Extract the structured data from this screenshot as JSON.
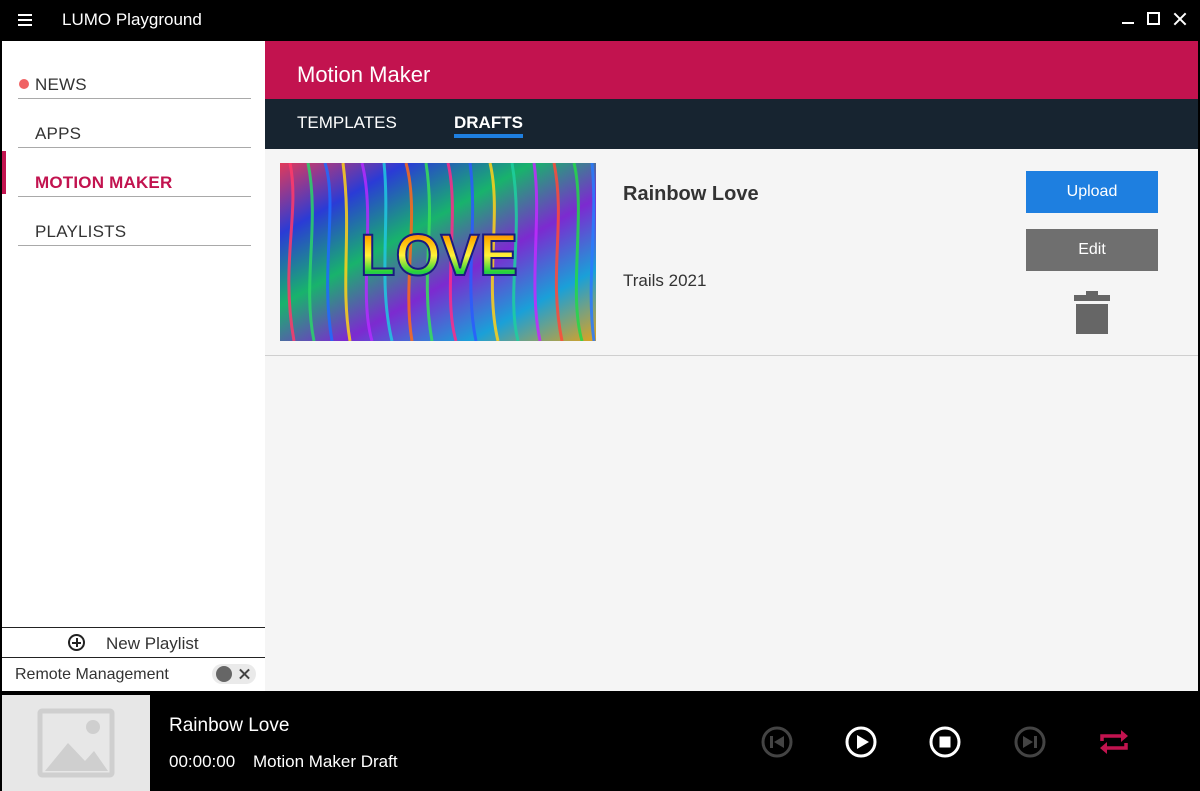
{
  "window": {
    "title": "LUMO Playground"
  },
  "sidebar": {
    "items": [
      {
        "label": "NEWS"
      },
      {
        "label": "APPS"
      },
      {
        "label": "MOTION MAKER"
      },
      {
        "label": "PLAYLISTS"
      }
    ],
    "new_playlist_label": "New Playlist",
    "remote_management_label": "Remote Management"
  },
  "main": {
    "header_title": "Motion Maker",
    "tabs": [
      {
        "label": "TEMPLATES"
      },
      {
        "label": "DRAFTS"
      }
    ],
    "drafts": [
      {
        "title": "Rainbow Love",
        "subtitle": "Trails 2021",
        "thumbnail_text": "LOVE",
        "upload_label": "Upload",
        "edit_label": "Edit"
      }
    ]
  },
  "player": {
    "title": "Rainbow Love",
    "time": "00:00:00",
    "status": "Motion Maker Draft"
  },
  "colors": {
    "accent": "#c2134f",
    "upload_button": "#1e7fe0",
    "edit_button": "#6f6f6f",
    "tabs_background": "#172430",
    "news_dot": "#f06263"
  },
  "icons": {
    "menu": "hamburger-icon",
    "minimize": "minimize-icon",
    "maximize": "maximize-icon",
    "close": "close-icon",
    "add": "add-circle-icon",
    "trash": "trash-icon",
    "previous": "skip-previous-icon",
    "play": "play-icon",
    "stop": "stop-icon",
    "next": "skip-next-icon",
    "repeat": "repeat-icon",
    "image_placeholder": "image-placeholder-icon"
  }
}
